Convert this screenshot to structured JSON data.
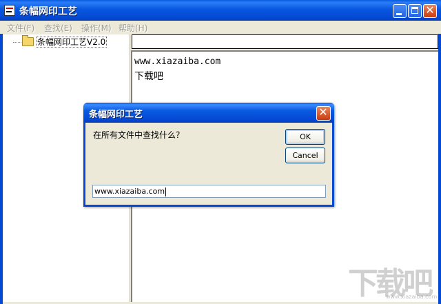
{
  "window": {
    "title": "条幅网印工艺",
    "controls": {
      "minimize": "minimize",
      "maximize": "maximize",
      "close": "✕"
    }
  },
  "menu": [
    {
      "label": "文件(F)"
    },
    {
      "label": "查找(E)"
    },
    {
      "label": "操作(M)"
    },
    {
      "label": "帮助(H)"
    }
  ],
  "tree": {
    "root_label": "条幅网印工艺V2.0",
    "icon": "folder-icon"
  },
  "path_field": {
    "value": ""
  },
  "content": {
    "lines": [
      "www.xiazaiba.com",
      "下载吧"
    ]
  },
  "dialog": {
    "title": "条幅网印工艺",
    "close": "✕",
    "prompt": "在所有文件中查找什么？",
    "ok_label": "OK",
    "cancel_label": "Cancel",
    "input_value": "www.xiazaiba.com"
  },
  "watermark": {
    "text": "下载吧",
    "sub": "www.xiazaiba.com"
  },
  "colors": {
    "title_blue": "#0449d3",
    "close_red": "#c93c0f",
    "face": "#ece9d8"
  }
}
